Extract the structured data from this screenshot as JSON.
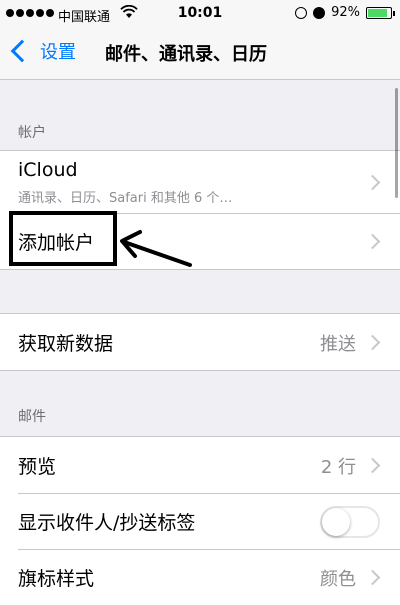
{
  "status_bar": {
    "carrier": "中国联通",
    "time": "10:01",
    "battery_percent": "92%",
    "battery_level": 0.92,
    "battery_color": "#4cd964"
  },
  "nav": {
    "back_label": "设置",
    "title": "邮件、通讯录、日历",
    "accent_color": "#007aff"
  },
  "accounts": {
    "header": "帐户",
    "items": [
      {
        "label": "iCloud",
        "detail": "通讯录、日历、Safari 和其他 6 个…"
      },
      {
        "label": "添加帐户"
      }
    ]
  },
  "fetch": {
    "label": "获取新数据",
    "value": "推送"
  },
  "mail": {
    "header": "邮件",
    "items": [
      {
        "label": "预览",
        "value": "2 行"
      },
      {
        "label": "显示收件人/抄送标签",
        "toggle": false
      },
      {
        "label": "旗标样式",
        "value": "颜色"
      }
    ]
  },
  "icons": [
    "wifi-icon",
    "lock-rotation-icon",
    "alarm-icon",
    "battery-icon",
    "chevron-left-icon",
    "chevron-right-icon",
    "arrow-icon"
  ]
}
